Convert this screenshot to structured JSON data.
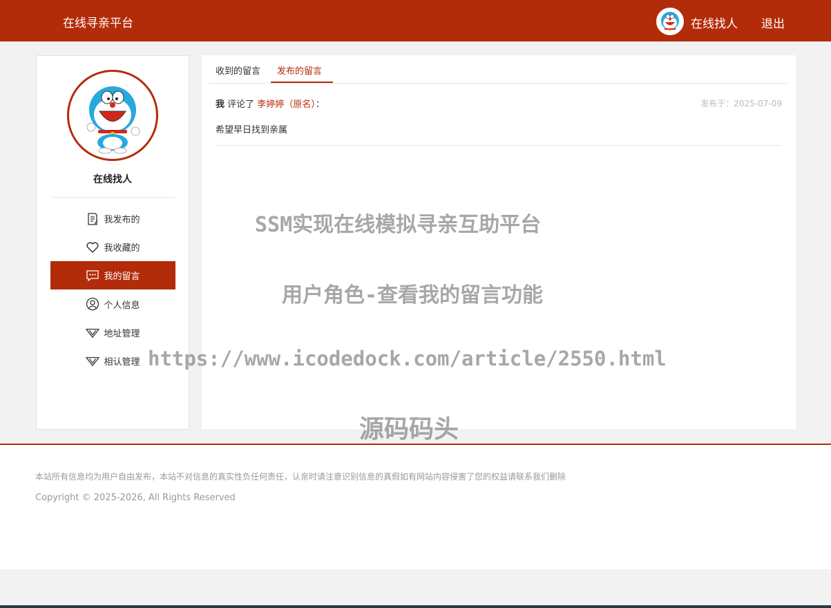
{
  "header": {
    "brand": "在线寻亲平台",
    "username": "在线找人",
    "logout": "退出"
  },
  "sidebar": {
    "name": "在线找人",
    "items": [
      {
        "label": "我发布的",
        "icon": "document-edit-icon"
      },
      {
        "label": "我收藏的",
        "icon": "heart-icon"
      },
      {
        "label": "我的留言",
        "icon": "message-icon",
        "active": true
      },
      {
        "label": "个人信息",
        "icon": "user-circle-icon"
      },
      {
        "label": "地址管理",
        "icon": "v-badge-icon"
      },
      {
        "label": "相认管理",
        "icon": "v-badge-icon"
      }
    ]
  },
  "tabs": [
    {
      "label": "收到的留言"
    },
    {
      "label": "发布的留言",
      "active": true
    }
  ],
  "comment": {
    "author": "我",
    "verb": "评论了",
    "target": "李婷婷（原名）",
    "colon": "：",
    "date": "发布于：2025-07-09",
    "content": "希望早日找到亲属"
  },
  "footer": {
    "disclaimer": "本站所有信息均为用户自由发布，本站不对信息的真实性负任何责任，认亲时请注意识别信息的真假如有网站内容侵害了您的权益请联系我们删除",
    "copyright": "Copyright © 2025-2026, All Rights Reserved"
  },
  "watermark": {
    "line1": "SSM实现在线模拟寻亲互助平台",
    "line2": "用户角色-查看我的留言功能",
    "line3": "https://www.icodedock.com/article/2550.html",
    "line4": "源码码头"
  },
  "colors": {
    "accent": "#b32c0a",
    "background": "#f2f2f2"
  }
}
